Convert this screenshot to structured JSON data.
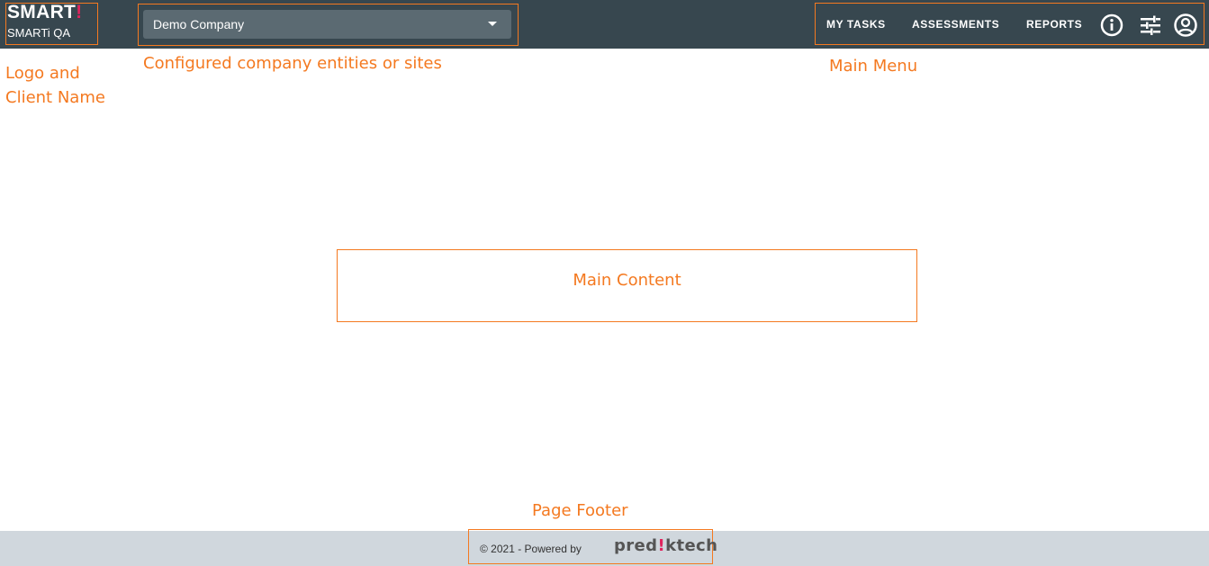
{
  "header": {
    "logo": {
      "text": "SMART",
      "mark": "!"
    },
    "client_name": "SMARTi QA",
    "company_select": {
      "value": "Demo Company"
    },
    "menu": {
      "items": [
        {
          "label": "MY TASKS"
        },
        {
          "label": "ASSESSMENTS"
        },
        {
          "label": "REPORTS"
        }
      ],
      "icons": [
        "info-icon",
        "tune-icon",
        "account-circle-icon"
      ]
    }
  },
  "annotations": {
    "logo_client": [
      "Logo and",
      "Client Name"
    ],
    "company_entities": "Configured company entities or sites",
    "main_menu": "Main Menu",
    "main_content": "Main Content",
    "page_footer": "Page Footer"
  },
  "footer": {
    "text": "© 2021 - Powered by",
    "brand": {
      "prefix": "pred",
      "mark": "!",
      "suffix": "ktech"
    }
  },
  "colors": {
    "topbar_bg": "#37474f",
    "annotation_orange": "#f47920",
    "brand_pink": "#e0245e",
    "footer_bg": "#d0d7dd",
    "select_bg": "#5b6a72"
  }
}
